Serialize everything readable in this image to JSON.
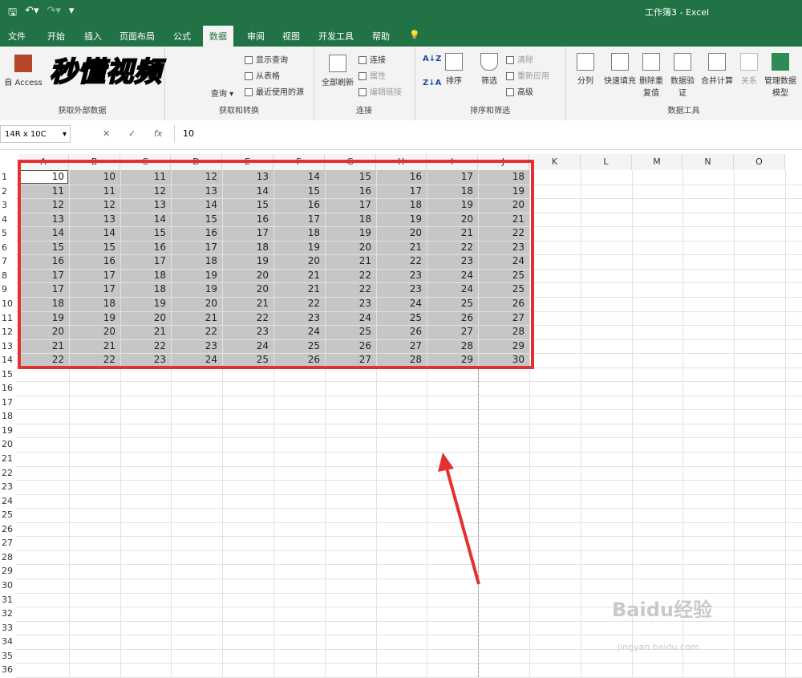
{
  "window": {
    "title": "工作簿3 - Excel"
  },
  "quick_access": {
    "save_icon": "save-icon",
    "undo_icon": "undo-icon",
    "redo_icon": "redo-icon",
    "more_icon": "customize-icon"
  },
  "tabs": [
    "文件",
    "开始",
    "插入",
    "页面布局",
    "公式",
    "数据",
    "审阅",
    "视图",
    "开发工具",
    "帮助"
  ],
  "active_tab": "数据",
  "ribbon": {
    "get_external": {
      "label": "获取外部数据",
      "access": "自 Access"
    },
    "get_transform": {
      "label": "获取和转换",
      "query": "查询",
      "show_queries": "显示查询",
      "from_table": "从表格",
      "recent_sources": "最近使用的源"
    },
    "connections": {
      "label": "连接",
      "refresh_all": "全部刷新",
      "connections": "连接",
      "properties": "属性",
      "edit_links": "编辑链接"
    },
    "sort_filter": {
      "label": "排序和筛选",
      "sort": "排序",
      "filter": "筛选",
      "clear": "清除",
      "reapply": "重新应用",
      "advanced": "高级",
      "az": "A↓Z",
      "za": "Z↓A"
    },
    "data_tools": {
      "label": "数据工具",
      "text_to_columns": "分列",
      "flash_fill": "快速填充",
      "remove_dup": "删除重复值",
      "validation": "数据验证",
      "consolidate": "合并计算",
      "relationships": "关系",
      "data_model": "管理数据模型"
    }
  },
  "watermark_logo": "秒懂视频",
  "formula_bar": {
    "name_box": "14R x 10C",
    "cancel": "✕",
    "enter": "✓",
    "fx": "fx",
    "formula": "10"
  },
  "columns": [
    "A",
    "B",
    "C",
    "D",
    "E",
    "F",
    "G",
    "H",
    "I",
    "J",
    "K",
    "L",
    "M",
    "N",
    "O"
  ],
  "rows": [
    "1",
    "2",
    "3",
    "4",
    "5",
    "6",
    "7",
    "8",
    "9",
    "10",
    "11",
    "12",
    "13",
    "14",
    "15",
    "16",
    "17",
    "18",
    "19",
    "20",
    "21",
    "22",
    "23",
    "24",
    "25",
    "26",
    "27",
    "28",
    "29",
    "30",
    "31",
    "32",
    "33",
    "34",
    "35",
    "36"
  ],
  "cells": [
    [
      10,
      10,
      11,
      12,
      13,
      14,
      15,
      16,
      17,
      18
    ],
    [
      11,
      11,
      12,
      13,
      14,
      15,
      16,
      17,
      18,
      19
    ],
    [
      12,
      12,
      13,
      14,
      15,
      16,
      17,
      18,
      19,
      20
    ],
    [
      13,
      13,
      14,
      15,
      16,
      17,
      18,
      19,
      20,
      21
    ],
    [
      14,
      14,
      15,
      16,
      17,
      18,
      19,
      20,
      21,
      22
    ],
    [
      15,
      15,
      16,
      17,
      18,
      19,
      20,
      21,
      22,
      23
    ],
    [
      16,
      16,
      17,
      18,
      19,
      20,
      21,
      22,
      23,
      24
    ],
    [
      17,
      17,
      18,
      19,
      20,
      21,
      22,
      23,
      24,
      25
    ],
    [
      17,
      17,
      18,
      19,
      20,
      21,
      22,
      23,
      24,
      25
    ],
    [
      18,
      18,
      19,
      20,
      21,
      22,
      23,
      24,
      25,
      26
    ],
    [
      19,
      19,
      20,
      21,
      22,
      23,
      24,
      25,
      26,
      27
    ],
    [
      20,
      20,
      21,
      22,
      23,
      24,
      25,
      26,
      27,
      28
    ],
    [
      21,
      21,
      22,
      23,
      24,
      25,
      26,
      27,
      28,
      29
    ],
    [
      22,
      22,
      23,
      24,
      25,
      26,
      27,
      28,
      29,
      30
    ]
  ],
  "baidu_watermark": {
    "text": "Baidu经验",
    "url": "jingyan.baidu.com"
  },
  "colors": {
    "excel_green": "#217346",
    "highlight_red": "#e53030",
    "selection_gray": "#c6c6c6"
  }
}
